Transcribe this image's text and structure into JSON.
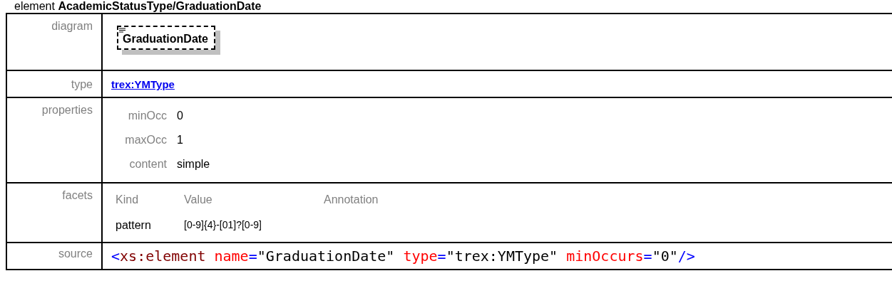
{
  "heading": {
    "prefix": "element",
    "name": "AcademicStatusType/GraduationDate"
  },
  "diagram": {
    "label": "diagram",
    "element": "GraduationDate"
  },
  "type": {
    "label": "type",
    "link": "trex:YMType"
  },
  "properties": {
    "label": "properties",
    "items": [
      {
        "name": "minOcc",
        "value": "0"
      },
      {
        "name": "maxOcc",
        "value": "1"
      },
      {
        "name": "content",
        "value": "simple"
      }
    ]
  },
  "facets": {
    "label": "facets",
    "columns": [
      "Kind",
      "Value",
      "Annotation"
    ],
    "rows": [
      {
        "kind": "pattern",
        "value": "[0-9]{4}-[01]?[0-9]",
        "annotation": ""
      }
    ]
  },
  "source": {
    "label": "source",
    "tokens": [
      {
        "kind": "punct",
        "text": "<"
      },
      {
        "kind": "tag",
        "text": "xs:element"
      },
      {
        "kind": "attr",
        "text": "name"
      },
      {
        "kind": "punct",
        "text": "="
      },
      {
        "kind": "value",
        "text": "\"GraduationDate\""
      },
      {
        "kind": "attr",
        "text": "type"
      },
      {
        "kind": "punct",
        "text": "="
      },
      {
        "kind": "value",
        "text": "\"trex:YMType\""
      },
      {
        "kind": "attr",
        "text": "minOccurs"
      },
      {
        "kind": "punct",
        "text": "="
      },
      {
        "kind": "value",
        "text": "\"0\""
      },
      {
        "kind": "punct",
        "text": "/>"
      }
    ]
  }
}
